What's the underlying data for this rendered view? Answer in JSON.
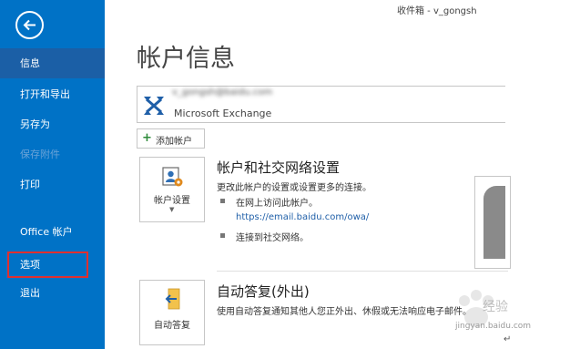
{
  "window": {
    "title": "收件箱 - v_gongsh"
  },
  "sidebar": {
    "items": [
      {
        "label": "信息"
      },
      {
        "label": "打开和导出"
      },
      {
        "label": "另存为"
      },
      {
        "label": "保存附件"
      },
      {
        "label": "打印"
      },
      {
        "label": "Office 帐户"
      },
      {
        "label": "选项"
      },
      {
        "label": "退出"
      }
    ],
    "active": "信息",
    "highlighted": "选项"
  },
  "main": {
    "title": "帐户信息",
    "account": {
      "email": "v_gongsh@baidu.com",
      "type": "Microsoft Exchange"
    },
    "add_account_label": "添加帐户",
    "account_settings": {
      "card_label": "帐户设置",
      "title": "帐户和社交网络设置",
      "description": "更改此帐户的设置或设置更多的连接。",
      "bullet1": "在网上访问此帐户。",
      "link": "https://email.baidu.com/owa/",
      "bullet2": "连接到社交网络。"
    },
    "auto_reply": {
      "card_label": "自动答复",
      "title": "自动答复(外出)",
      "description": "使用自动答复通知其他人您正外出、休假或无法响应电子邮件。"
    }
  },
  "watermark": {
    "brand": "经验",
    "site": "jingyan.baidu.com"
  },
  "colors": {
    "sidebar": "#0072C6",
    "highlight_border": "#e0302f",
    "link": "#1f5fa8"
  },
  "icons": [
    "back-arrow-icon",
    "exchange-logo-icon",
    "plus-icon",
    "account-settings-icon",
    "auto-reply-icon"
  ]
}
